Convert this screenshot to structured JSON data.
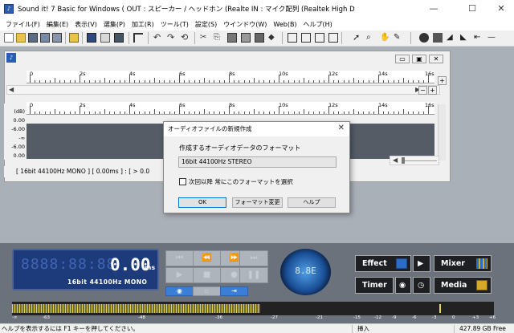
{
  "window": {
    "title": "Sound it! 7 Basic for Windows  ( OUT : スピーカー / ヘッドホン (Realte  IN : マイク配列 (Realtek High Defini )",
    "minimize": "—",
    "maximize": "☐",
    "close": "✕"
  },
  "menu": [
    "ファイル(F)",
    "編集(E)",
    "表示(V)",
    "選集(P)",
    "加工(R)",
    "ツール(T)",
    "設定(S)",
    "ウインドウ(W)",
    "Web(B)",
    "ヘルプ(H)"
  ],
  "document": {
    "ruler_top": [
      "0",
      "2s",
      "4s",
      "6s",
      "8s",
      "10s",
      "12s",
      "14s",
      "16s"
    ],
    "ruler_track": [
      "0",
      "2s",
      "4s",
      "6s",
      "8s",
      "10s",
      "12s",
      "14s",
      "16s"
    ],
    "db_unit": "(dB)",
    "db_labels": [
      "0.00",
      "-6.00",
      "-∞",
      "-6.00",
      "0.00"
    ],
    "status": "[ 16bit   44100Hz   MONO ]  [ 0.00ms ] : [ > 0.0"
  },
  "dialog": {
    "title": "オーディオファイルの新規作成",
    "label": "作成するオーディオデータのフォーマット",
    "format_value": "16bit 44100Hz STEREO",
    "checkbox_label": "次回以降 常にこのフォーマットを選択",
    "ok": "OK",
    "change_format": "フォーマット変更",
    "help": "ヘルプ"
  },
  "player": {
    "digits": "8888:88:88",
    "time": "0.00",
    "time_unit": "ms",
    "format": "16bit   44100Hz  MONO",
    "knob_value": "8.8E"
  },
  "buttons": {
    "effect": "Effect",
    "mixer": "Mixer",
    "timer": "Timer",
    "media": "Media"
  },
  "meter": {
    "level": 0.515,
    "scale": [
      "-∞",
      "-63",
      "-48",
      "-36",
      "-27",
      "-21",
      "-15",
      "-12",
      "-9",
      "-6",
      "-3",
      "0",
      "+3",
      "+6"
    ]
  },
  "statusbar": {
    "help": "ヘルプを表示するには F1 キーを押してください。",
    "mode": "挿入",
    "free": "427.89 GB Free"
  },
  "colors": {
    "lcd_bg": "#1d3a7a",
    "workspace": "#aab0b8",
    "panel": "#6b727c",
    "accent_blue": "#3a7ed6",
    "meter_yellow": "#e6d34a"
  }
}
